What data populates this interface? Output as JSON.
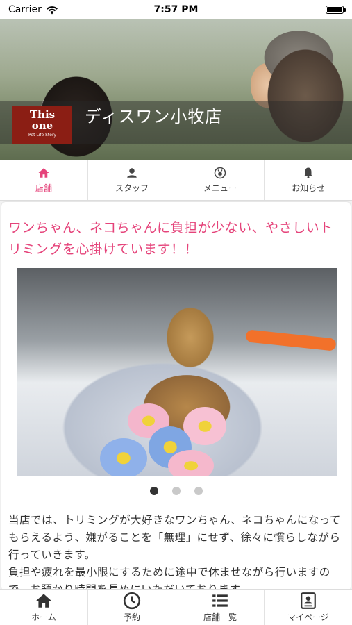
{
  "status": {
    "carrier": "Carrier",
    "time": "7:57 PM"
  },
  "hero": {
    "shop_name": "ディスワン小牧店",
    "logo_line1": "This",
    "logo_line2": "one",
    "logo_sub": "Pet Life Story"
  },
  "tabs": [
    {
      "label": "店舗",
      "icon": "home-icon",
      "active": true
    },
    {
      "label": "スタッフ",
      "icon": "person-icon",
      "active": false
    },
    {
      "label": "メニュー",
      "icon": "yen-icon",
      "active": false
    },
    {
      "label": "お知らせ",
      "icon": "bell-icon",
      "active": false
    }
  ],
  "content": {
    "headline": "ワンちゃん、ネコちゃんに負担が少ない、やさしいトリミングを心掛けています！！",
    "carousel": {
      "current": 1,
      "total": 3
    },
    "body": "当店では、トリミングが大好きなワンちゃん、ネコちゃんになってもらえるよう、嫌がることを「無理」にせず、徐々に慣らしながら行っていきます。\n負担や疲れを最小限にするために途中で休ませながら行いますので、お預かり時間を長めにいただいております。"
  },
  "bottom_nav": [
    {
      "label": "ホーム",
      "icon": "home-icon"
    },
    {
      "label": "予約",
      "icon": "clock-icon"
    },
    {
      "label": "店舗一覧",
      "icon": "list-icon"
    },
    {
      "label": "マイページ",
      "icon": "id-card-icon"
    }
  ],
  "colors": {
    "accent": "#e5437a",
    "logo_bg": "#8b1e14"
  }
}
